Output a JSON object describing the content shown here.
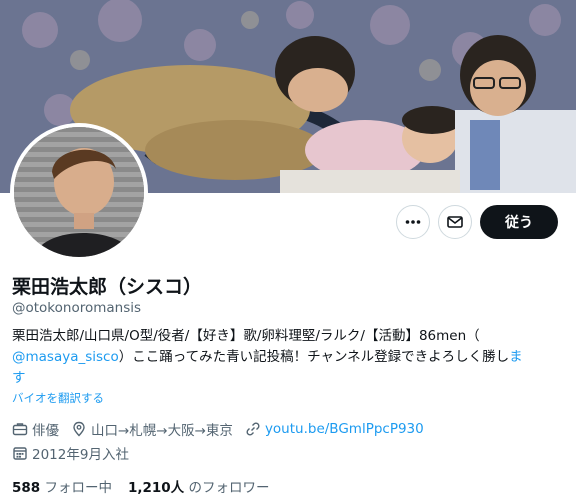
{
  "profile": {
    "display_name": "栗田浩太郎（シスコ）",
    "handle": "@otokonoromansis",
    "bio_text": "栗田浩太郎/山口県/O型/役者/【好き】歌/卵料理堅/ラルク/【活動】86men（",
    "bio_mention": "@masaya_sisco",
    "bio_text_2": "）ここ踊ってみた青い記投稿！チャンネル登録できよろしく勝し",
    "bio_tail_link": "ま",
    "bio_tail_link_2": "す",
    "translate_label": "バイオを翻訳する",
    "category": "俳優",
    "location": "山口→札幌→大阪→東京",
    "website": "youtu.be/BGmlPpcP930",
    "joined": "2012年9月入社"
  },
  "stats": {
    "following_count": "588",
    "following_label": "フォロー中",
    "followers_count": "1,210人",
    "followers_label": "のフォロワー"
  },
  "actions": {
    "more_icon": "more-icon",
    "message_icon": "envelope-icon",
    "follow_label": "従う"
  },
  "colors": {
    "link": "#1d9bf0",
    "follow_bg": "#0f1419",
    "secondary_text": "#536471"
  }
}
